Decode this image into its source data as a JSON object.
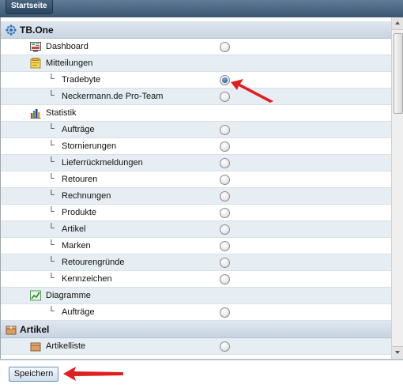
{
  "header": {
    "start_tab": "Startseite"
  },
  "tree": {
    "section1_title": "TB.One",
    "dashboard": "Dashboard",
    "mitteilungen": "Mitteilungen",
    "tradebyte": "Tradebyte",
    "neckermann": "Neckermann.de Pro-Team",
    "statistik": "Statistik",
    "auftraege": "Aufträge",
    "stornierungen": "Stornierungen",
    "lieferrueck": "Lieferrückmeldungen",
    "retouren": "Retouren",
    "rechnungen": "Rechnungen",
    "produkte": "Produkte",
    "artikel_item": "Artikel",
    "marken": "Marken",
    "retourengruende": "Retourengründe",
    "kennzeichen": "Kennzeichen",
    "diagramme": "Diagramme",
    "diag_auftraege": "Aufträge",
    "section2_title": "Artikel",
    "artikelliste": "Artikelliste"
  },
  "selected_radio": "Tradebyte",
  "footer": {
    "save_label": "Speichern"
  },
  "colors": {
    "annotation_arrow": "#e02020",
    "accent": "#3b5670"
  }
}
